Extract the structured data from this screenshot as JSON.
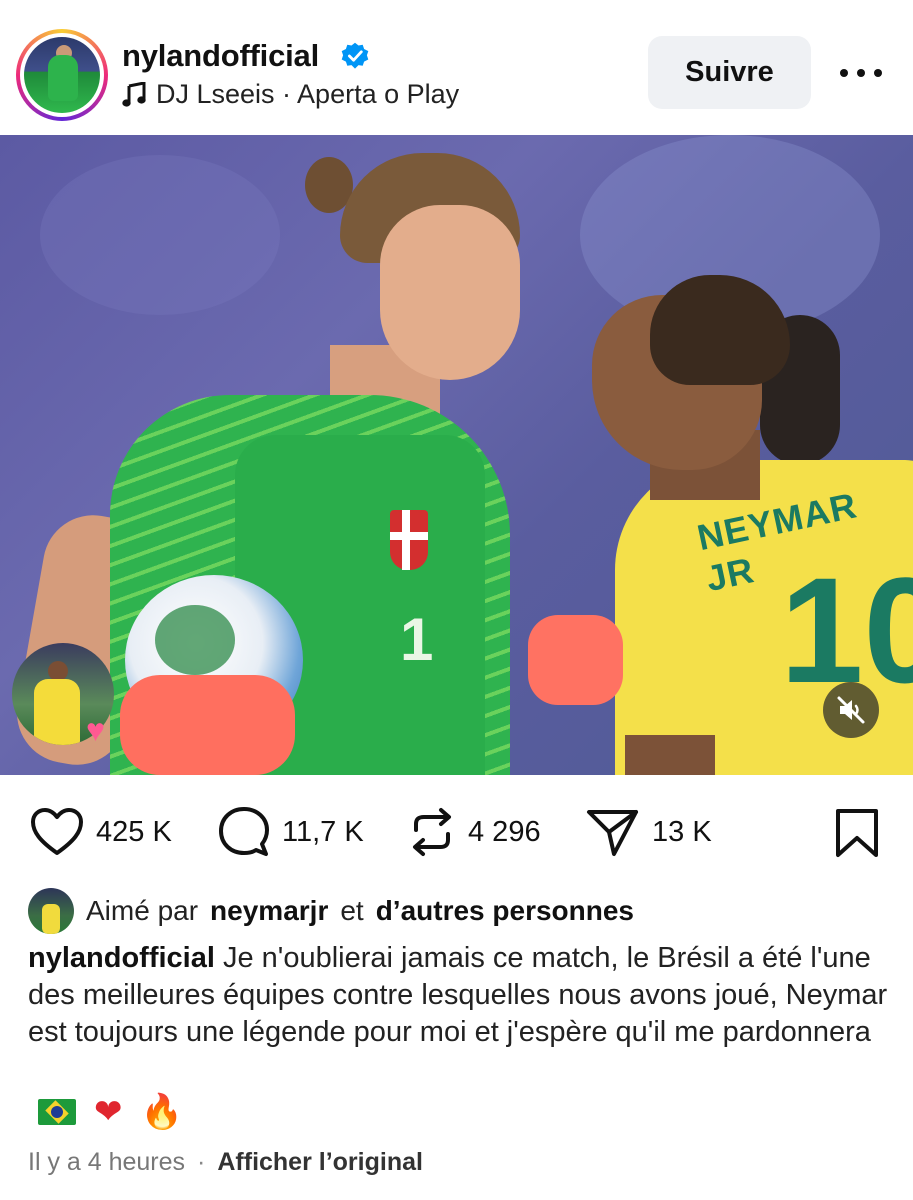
{
  "header": {
    "username": "nylandofficial",
    "verified": true,
    "music": "DJ Lseeis · Aperta o Play",
    "follow_label": "Suivre",
    "more_icon": "more-horizontal-icon"
  },
  "media": {
    "jersey_name": "NEYMAR JR",
    "jersey_number": "10",
    "gk_number": "1",
    "muted": true
  },
  "actions": {
    "likes_count": "425 K",
    "comments_count": "11,7 K",
    "reposts_count": "4 296",
    "shares_count": "13 K"
  },
  "likes_line": {
    "prefix": "Aimé par",
    "user": "neymarjr",
    "connector": "et",
    "others": "d’autres personnes"
  },
  "caption": {
    "user": "nylandofficial",
    "text": "Je n'oublierai jamais ce match, le Brésil a été l'une des meilleures équipes contre lesquelles nous avons joué, Neymar est toujours une légende pour moi et j'espère qu'il me pardonnera"
  },
  "emojis": {
    "heart": "❤",
    "fire": "🔥"
  },
  "footer": {
    "time": "Il y a 4 heures",
    "separator": "·",
    "translate_link": "Afficher l’original"
  },
  "colors": {
    "verified_blue": "#0095f6",
    "follow_bg": "#eff1f4"
  }
}
